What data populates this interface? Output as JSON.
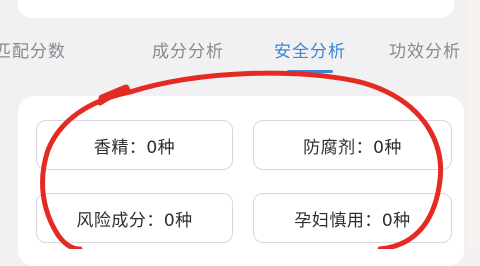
{
  "tabs": [
    {
      "label": "匹配分数",
      "active": false
    },
    {
      "label": "成分分析",
      "active": false
    },
    {
      "label": "安全分析",
      "active": true
    },
    {
      "label": "功效分析",
      "active": false
    }
  ],
  "safety_tags": [
    {
      "text": "香精：0种"
    },
    {
      "text": "防腐剂：0种"
    },
    {
      "text": "风险成分：0种"
    },
    {
      "text": "孕妇慎用：0种"
    }
  ],
  "colors": {
    "accent": "#3a86d8",
    "annotation": "#e32b24",
    "tag_border": "#d8d8dc"
  }
}
